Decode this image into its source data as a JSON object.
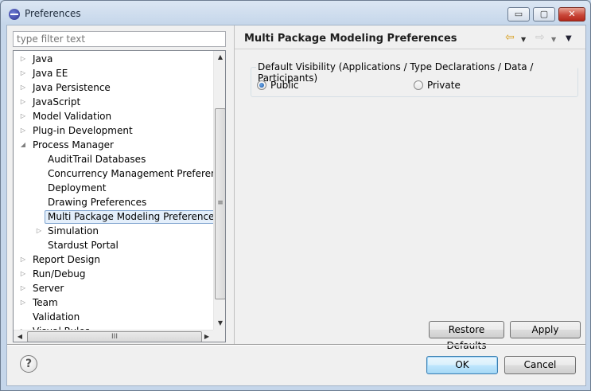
{
  "window": {
    "title": "Preferences",
    "min_label": "▭",
    "max_label": "▢",
    "close_label": "✕"
  },
  "filter": {
    "placeholder": "type filter text"
  },
  "tree": {
    "items": [
      {
        "label": "Java",
        "expander": "▷"
      },
      {
        "label": "Java EE",
        "expander": "▷"
      },
      {
        "label": "Java Persistence",
        "expander": "▷"
      },
      {
        "label": "JavaScript",
        "expander": "▷"
      },
      {
        "label": "Model Validation",
        "expander": "▷"
      },
      {
        "label": "Plug-in Development",
        "expander": "▷"
      },
      {
        "label": "Process Manager",
        "expander": "◢"
      },
      {
        "label": "AuditTrail Databases",
        "expander": ""
      },
      {
        "label": "Concurrency Management Preferences",
        "expander": ""
      },
      {
        "label": "Deployment",
        "expander": ""
      },
      {
        "label": "Drawing Preferences",
        "expander": ""
      },
      {
        "label": "Multi Package Modeling Preferences",
        "expander": "",
        "selected": true
      },
      {
        "label": "Simulation",
        "expander": "▷"
      },
      {
        "label": "Stardust Portal",
        "expander": ""
      },
      {
        "label": "Report Design",
        "expander": "▷"
      },
      {
        "label": "Run/Debug",
        "expander": "▷"
      },
      {
        "label": "Server",
        "expander": "▷"
      },
      {
        "label": "Team",
        "expander": "▷"
      },
      {
        "label": "Validation",
        "expander": ""
      },
      {
        "label": "Visual Rules",
        "expander": "▷"
      }
    ],
    "vscroll": {
      "up": "▲",
      "down": "▼",
      "grip": "≡"
    },
    "hscroll": {
      "left": "◀",
      "right": "▶",
      "grip": "III"
    }
  },
  "page": {
    "title": "Multi Package Modeling Preferences",
    "nav": {
      "back": "⇦",
      "back_menu": "▼",
      "forward": "⇨",
      "forward_menu": "▼",
      "view_menu": "▼"
    },
    "group": {
      "legend": "Default Visibility (Applications / Type Declarations / Data / Participants)",
      "options": [
        {
          "label": "Public",
          "checked": true
        },
        {
          "label": "Private",
          "checked": false
        }
      ]
    },
    "restore_defaults": "Restore Defaults",
    "apply": "Apply"
  },
  "footer": {
    "help": "?",
    "ok": "OK",
    "cancel": "Cancel"
  }
}
